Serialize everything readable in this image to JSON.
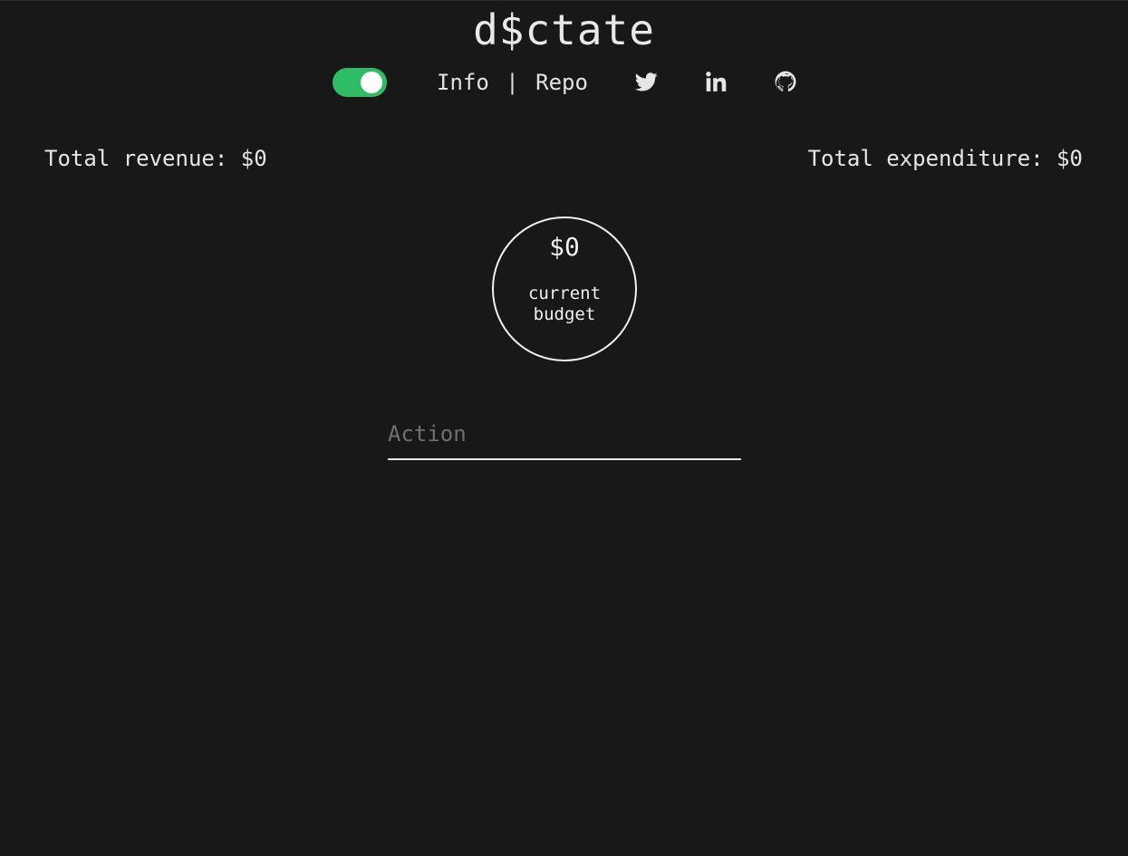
{
  "app": {
    "title": "d$ctate"
  },
  "header": {
    "toggle_on": true,
    "links": {
      "info": "Info",
      "separator": "|",
      "repo": "Repo"
    },
    "social": [
      {
        "icon": "twitter-icon"
      },
      {
        "icon": "linkedin-icon"
      },
      {
        "icon": "github-icon"
      }
    ],
    "accent_color": "#2ebd64"
  },
  "stats": {
    "revenue": "Total revenue: $0",
    "expenditure": "Total expenditure: $0"
  },
  "budget": {
    "value": "$0",
    "label": "current\nbudget"
  },
  "action": {
    "placeholder": "Action",
    "value": ""
  }
}
